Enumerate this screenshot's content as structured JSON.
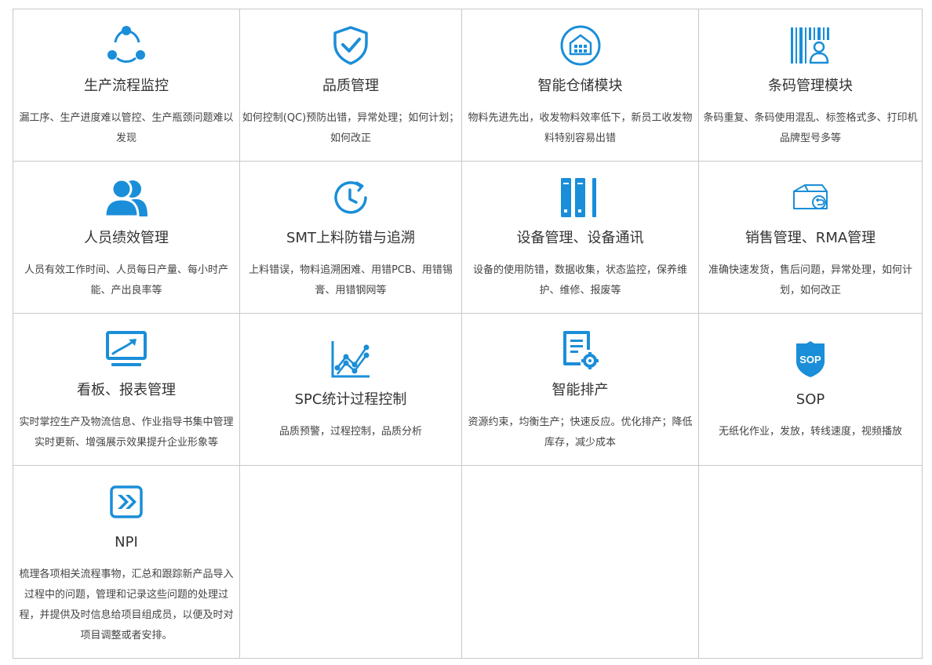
{
  "accent": "#1a8ed8",
  "modules": [
    {
      "title": "生产流程监控",
      "desc": "漏工序、生产进度难以管控、生产瓶颈问题难以发现",
      "icon": "share-network-icon"
    },
    {
      "title": "品质管理",
      "desc": "如何控制(QC)预防出错，异常处理；如何计划；如何改正",
      "icon": "shield-check-icon"
    },
    {
      "title": "智能仓储模块",
      "desc": "物料先进先出，收发物料效率低下，新员工收发物料特别容易出错",
      "icon": "warehouse-icon"
    },
    {
      "title": "条码管理模块",
      "desc": "条码重复、条码使用混乱、标签格式多、打印机品牌型号多等",
      "icon": "barcode-user-icon"
    },
    {
      "title": "人员绩效管理",
      "desc": "人员有效工作时间、人员每日产量、每小时产能、产出良率等",
      "icon": "users-icon"
    },
    {
      "title": "SMT上料防错与追溯",
      "desc": "上料错误，物料追溯困难、用错PCB、用错锡膏、用错钢网等",
      "icon": "clock-icon"
    },
    {
      "title": "设备管理、设备通讯",
      "desc": "设备的使用防错，数据收集，状态监控，保养维护、维修、报废等",
      "icon": "server-rack-icon"
    },
    {
      "title": "销售管理、RMA管理",
      "desc": "准确快速发货，售后问题，异常处理，如何计划，如何改正",
      "icon": "box-return-icon"
    },
    {
      "title": "看板、报表管理",
      "desc": "实时掌控生产及物流信息、作业指导书集中管理实时更新、增强展示效果提升企业形象等",
      "icon": "monitor-trend-icon"
    },
    {
      "title": "SPC统计过程控制",
      "desc": "品质预警，过程控制，品质分析",
      "icon": "line-chart-icon"
    },
    {
      "title": "智能排产",
      "desc": "资源约束，均衡生产；快速反应。优化排产；降低库存，减少成本",
      "icon": "document-gear-icon"
    },
    {
      "title": "SOP",
      "desc": "无纸化作业，发放，转线速度，视频播放",
      "icon": "sop-shield-icon",
      "badge": "SOP"
    },
    {
      "title": "NPI",
      "desc": "梳理各项相关流程事物，汇总和跟踪新产品导入过程中的问题，管理和记录这些问题的处理过程，并提供及时信息给项目组成员，以便及时对项目调整或者安排。",
      "icon": "forward-arrows-icon"
    }
  ]
}
